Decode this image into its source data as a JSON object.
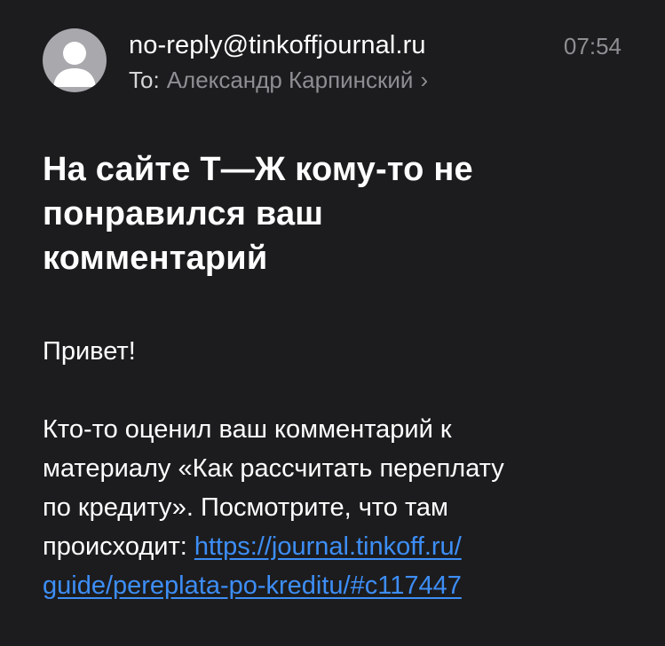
{
  "header": {
    "sender": "no-reply@tinkoffjournal.ru",
    "time": "07:54",
    "to_label": "To:",
    "recipient": "Александр Карпинский",
    "recipient_chevron": "chevron-right-icon",
    "avatar_icon": "person-icon"
  },
  "subject": {
    "lines": [
      "На сайте Т—Ж кому-то не",
      "понравился ваш",
      "комментарий"
    ]
  },
  "body": {
    "greeting": "Привет!",
    "paragraph_lines": [
      "Кто-то оценил ваш комментарий к",
      "материалу «Как рассчитать переплату",
      "по кредиту». Посмотрите, что там"
    ],
    "last_line_prefix": "происходит: ",
    "link_line1": "https://journal.tinkoff.ru/",
    "link_line2": "guide/pereplata-po-kreditu/#c117447"
  },
  "colors": {
    "background": "#1c1c1e",
    "text": "#ffffff",
    "secondary": "#8e8e93",
    "link": "#3d8ef7",
    "avatar": "#a8a8ad"
  }
}
